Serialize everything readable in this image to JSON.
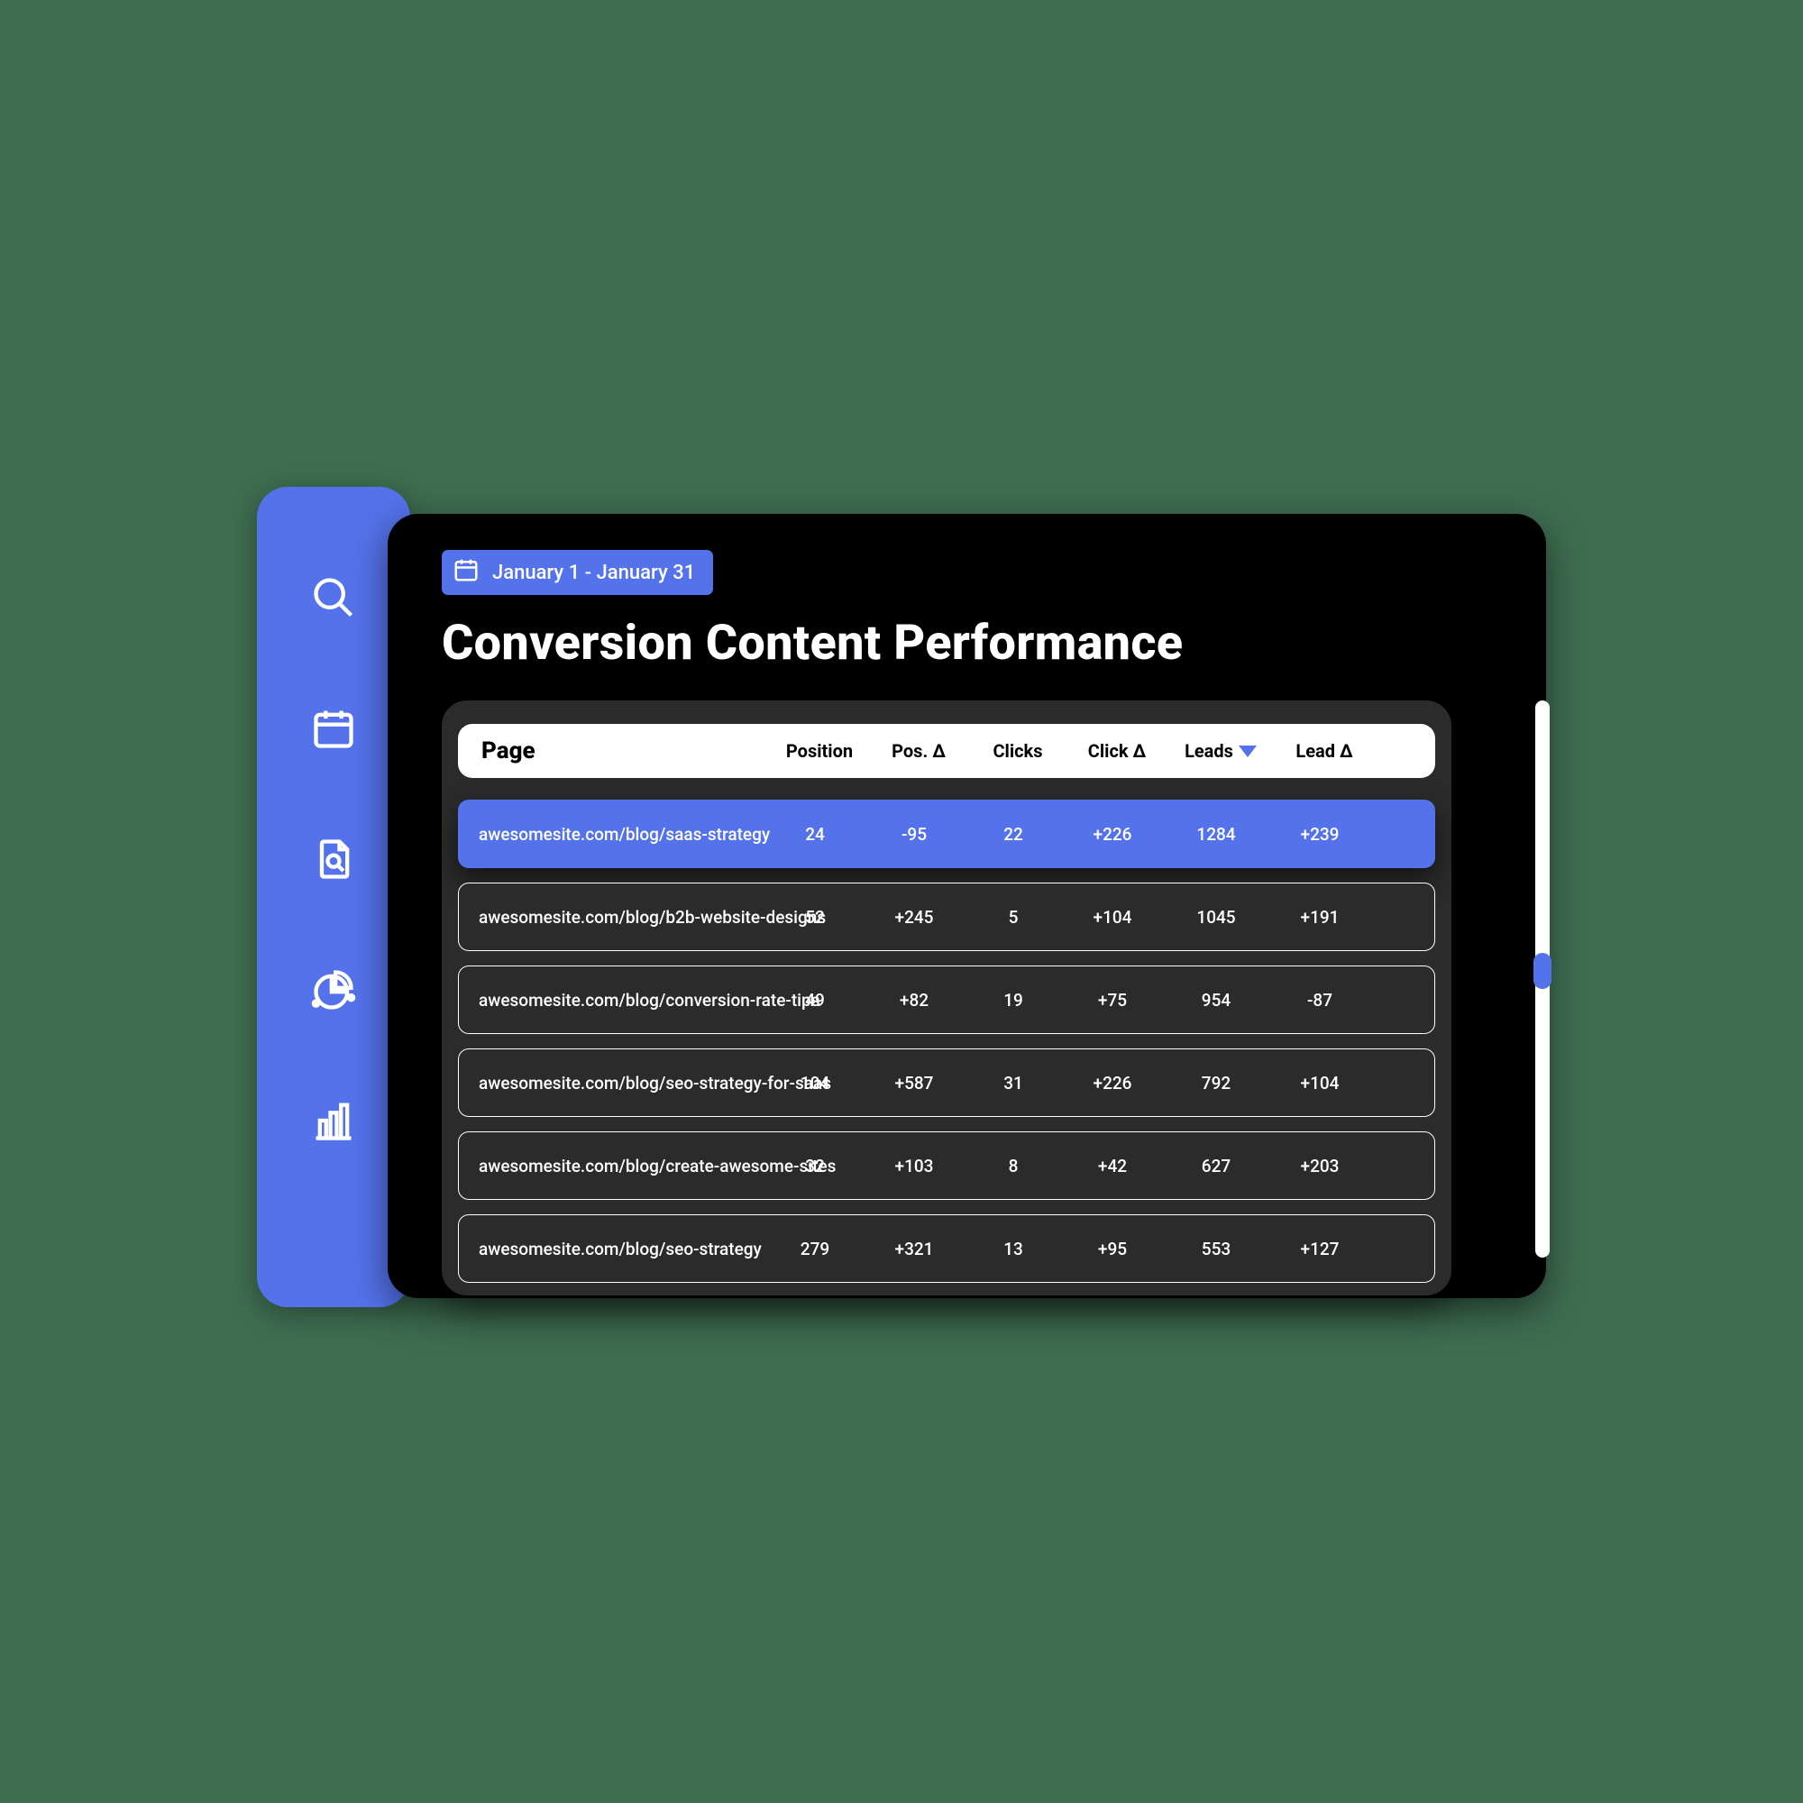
{
  "colors": {
    "accent": "#5472ea",
    "background": "#3e6d50"
  },
  "sidebar": {
    "items": [
      {
        "name": "search-icon"
      },
      {
        "name": "calendar-icon"
      },
      {
        "name": "document-search-icon"
      },
      {
        "name": "pie-chart-icon"
      },
      {
        "name": "bar-chart-icon"
      }
    ]
  },
  "dateRange": {
    "label": "January 1 - January 31"
  },
  "page": {
    "title": "Conversion Content Performance"
  },
  "table": {
    "headers": {
      "page": "Page",
      "position": "Position",
      "pos_delta": "Pos. Δ",
      "clicks": "Clicks",
      "click_delta": "Click Δ",
      "leads": "Leads",
      "lead_delta": "Lead Δ"
    },
    "sort": {
      "column": "leads",
      "direction": "desc"
    },
    "rows": [
      {
        "page": "awesomesite.com/blog/saas-strategy",
        "position": "24",
        "pos_delta": "-95",
        "clicks": "22",
        "click_delta": "+226",
        "leads": "1284",
        "lead_delta": "+239",
        "active": true
      },
      {
        "page": "awesomesite.com/blog/b2b-website-designs",
        "position": "52",
        "pos_delta": "+245",
        "clicks": "5",
        "click_delta": "+104",
        "leads": "1045",
        "lead_delta": "+191",
        "active": false
      },
      {
        "page": "awesomesite.com/blog/conversion-rate-tips",
        "position": "49",
        "pos_delta": "+82",
        "clicks": "19",
        "click_delta": "+75",
        "leads": "954",
        "lead_delta": "-87",
        "active": false
      },
      {
        "page": "awesomesite.com/blog/seo-strategy-for-saas",
        "position": "104",
        "pos_delta": "+587",
        "clicks": "31",
        "click_delta": "+226",
        "leads": "792",
        "lead_delta": "+104",
        "active": false
      },
      {
        "page": "awesomesite.com/blog/create-awesome-sites",
        "position": "32",
        "pos_delta": "+103",
        "clicks": "8",
        "click_delta": "+42",
        "leads": "627",
        "lead_delta": "+203",
        "active": false
      },
      {
        "page": "awesomesite.com/blog/seo-strategy",
        "position": "279",
        "pos_delta": "+321",
        "clicks": "13",
        "click_delta": "+95",
        "leads": "553",
        "lead_delta": "+127",
        "active": false
      }
    ]
  }
}
